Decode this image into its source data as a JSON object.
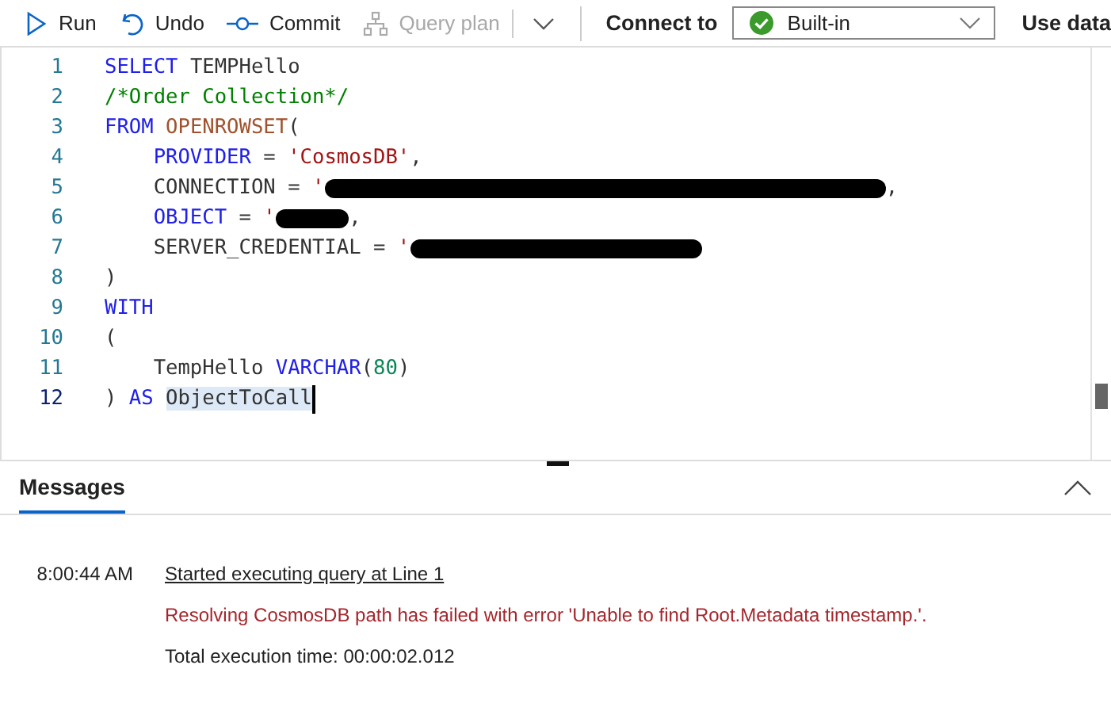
{
  "toolbar": {
    "buttons": [
      {
        "label": "Run",
        "kind": "run",
        "disabled": false
      },
      {
        "label": "Undo",
        "kind": "undo",
        "disabled": false
      },
      {
        "label": "Commit",
        "kind": "commit",
        "disabled": false
      },
      {
        "label": "Query plan",
        "kind": "plan",
        "disabled": true
      }
    ],
    "connect_label": "Connect to",
    "connection": "Built-in",
    "database_label": "Use data"
  },
  "editor": {
    "lines": [
      {
        "number": "1",
        "current": false,
        "tokens": [
          {
            "t": "SELECT",
            "kind": "keyword"
          },
          {
            "t": " TEMPHello",
            "kind": "plain"
          }
        ]
      },
      {
        "number": "2",
        "current": false,
        "tokens": [
          {
            "t": "/*Order Collection*/",
            "kind": "comment"
          }
        ]
      },
      {
        "number": "3",
        "current": false,
        "tokens": [
          {
            "t": "FROM ",
            "kind": "keyword"
          },
          {
            "t": "OPENROWSET",
            "kind": "function"
          },
          {
            "t": "(",
            "kind": "plain"
          }
        ]
      },
      {
        "number": "4",
        "current": false,
        "tokens": [
          {
            "t": "    PROVIDER",
            "kind": "keyword"
          },
          {
            "t": " = ",
            "kind": "plain"
          },
          {
            "t": "'CosmosDB'",
            "kind": "string"
          },
          {
            "t": ",",
            "kind": "plain"
          }
        ]
      },
      {
        "number": "5",
        "current": false,
        "tokens": [
          {
            "t": "    CONNECTION = ",
            "kind": "plain"
          },
          {
            "t": "'",
            "kind": "string"
          },
          {
            "kind": "redacted"
          },
          {
            "t": ",",
            "kind": "plain"
          }
        ]
      },
      {
        "number": "6",
        "current": false,
        "tokens": [
          {
            "t": "    OBJECT",
            "kind": "keyword"
          },
          {
            "t": " = ",
            "kind": "plain"
          },
          {
            "t": "'",
            "kind": "string"
          },
          {
            "kind": "redacted"
          },
          {
            "t": ",",
            "kind": "plain"
          }
        ]
      },
      {
        "number": "7",
        "current": false,
        "tokens": [
          {
            "t": "    SERVER_CREDENTIAL = ",
            "kind": "plain"
          },
          {
            "t": "'",
            "kind": "string"
          },
          {
            "kind": "redacted"
          }
        ]
      },
      {
        "number": "8",
        "current": false,
        "tokens": [
          {
            "t": ")",
            "kind": "plain"
          }
        ]
      },
      {
        "number": "9",
        "current": false,
        "tokens": [
          {
            "t": "WITH",
            "kind": "keyword"
          }
        ]
      },
      {
        "number": "10",
        "current": false,
        "tokens": [
          {
            "t": "(",
            "kind": "plain"
          }
        ]
      },
      {
        "number": "11",
        "current": false,
        "tokens": [
          {
            "t": "    TempHello ",
            "kind": "plain"
          },
          {
            "t": "VARCHAR",
            "kind": "keyword"
          },
          {
            "t": "(",
            "kind": "plain"
          },
          {
            "t": "80",
            "kind": "number"
          },
          {
            "t": ")",
            "kind": "plain"
          }
        ]
      },
      {
        "number": "12",
        "current": true,
        "tokens": [
          {
            "t": ") ",
            "kind": "plain"
          },
          {
            "t": "AS ",
            "kind": "keyword"
          },
          {
            "t": "ObjectToCall",
            "kind": "selection"
          }
        ]
      }
    ]
  },
  "results": {
    "tabs": [
      {
        "label": "Messages",
        "selected": true
      }
    ],
    "messages": [
      {
        "time": "8:00:44 AM",
        "text": "Started executing query at Line 1",
        "kind": "link"
      },
      {
        "text": "Resolving CosmosDB path has failed with error 'Unable to find Root.Metadata timestamp.'.",
        "kind": "error"
      },
      {
        "text": "Total execution time: 00:00:02.012",
        "kind": "info"
      }
    ]
  }
}
